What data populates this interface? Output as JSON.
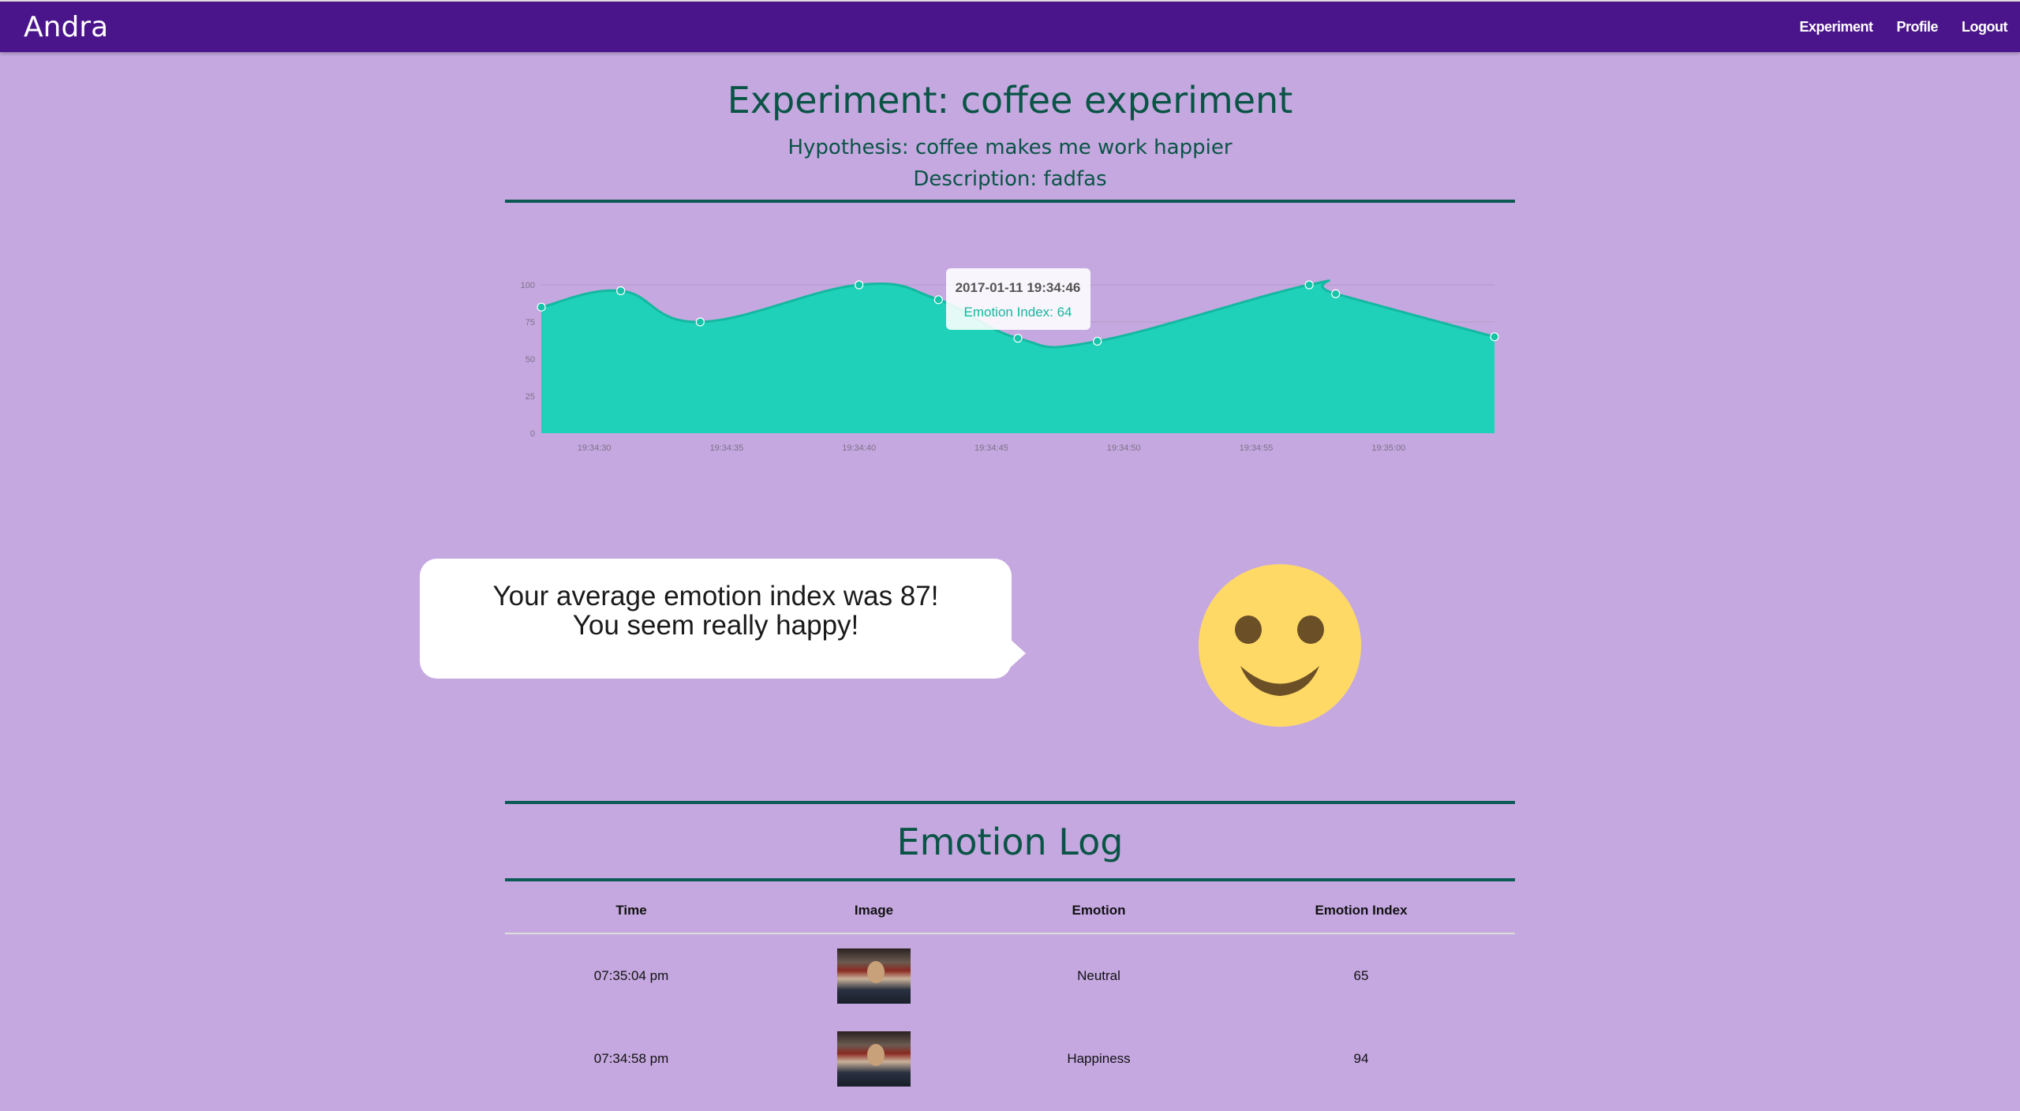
{
  "nav": {
    "brand": "Andra",
    "links": [
      "Experiment",
      "Profile",
      "Logout"
    ]
  },
  "header": {
    "title": "Experiment: coffee experiment",
    "hypothesis": "Hypothesis: coffee makes me work happier",
    "description": "Description: fadfas"
  },
  "colors": {
    "navbar": "#4a148a",
    "background": "#c5a8e0",
    "accent": "#1fd1b9",
    "heading": "#0a5446",
    "smiley": "#ffd966"
  },
  "chart_data": {
    "type": "area",
    "series_name": "Emotion Index",
    "points": [
      {
        "t": "19:34:28",
        "v": 85
      },
      {
        "t": "19:34:31",
        "v": 96
      },
      {
        "t": "19:34:34",
        "v": 75
      },
      {
        "t": "19:34:40",
        "v": 100
      },
      {
        "t": "19:34:43",
        "v": 90
      },
      {
        "t": "19:34:46",
        "v": 64
      },
      {
        "t": "19:34:49",
        "v": 62
      },
      {
        "t": "19:34:57",
        "v": 100
      },
      {
        "t": "19:34:58",
        "v": 94
      },
      {
        "t": "19:35:04",
        "v": 65
      }
    ],
    "y_ticks": [
      "0",
      "25",
      "50",
      "75",
      "100"
    ],
    "ylim": [
      0,
      100
    ],
    "x_ticks": [
      "19:34:30",
      "19:34:35",
      "19:34:40",
      "19:34:45",
      "19:34:50",
      "19:34:55",
      "19:35:00"
    ],
    "xlim": [
      "19:34:28",
      "19:35:04"
    ],
    "grid": true,
    "tooltip": {
      "title": "2017-01-11 19:34:46",
      "label": "Emotion Index: 64",
      "t": "19:34:46"
    }
  },
  "summary": {
    "line1": "Your average emotion index was 87!",
    "line2": "You seem really happy!",
    "icon": "smiley-face-icon"
  },
  "log": {
    "title": "Emotion Log",
    "columns": [
      "Time",
      "Image",
      "Emotion",
      "Emotion Index"
    ],
    "rows": [
      {
        "time": "07:35:04 pm",
        "emotion": "Neutral",
        "index": "65"
      },
      {
        "time": "07:34:58 pm",
        "emotion": "Happiness",
        "index": "94"
      }
    ]
  }
}
